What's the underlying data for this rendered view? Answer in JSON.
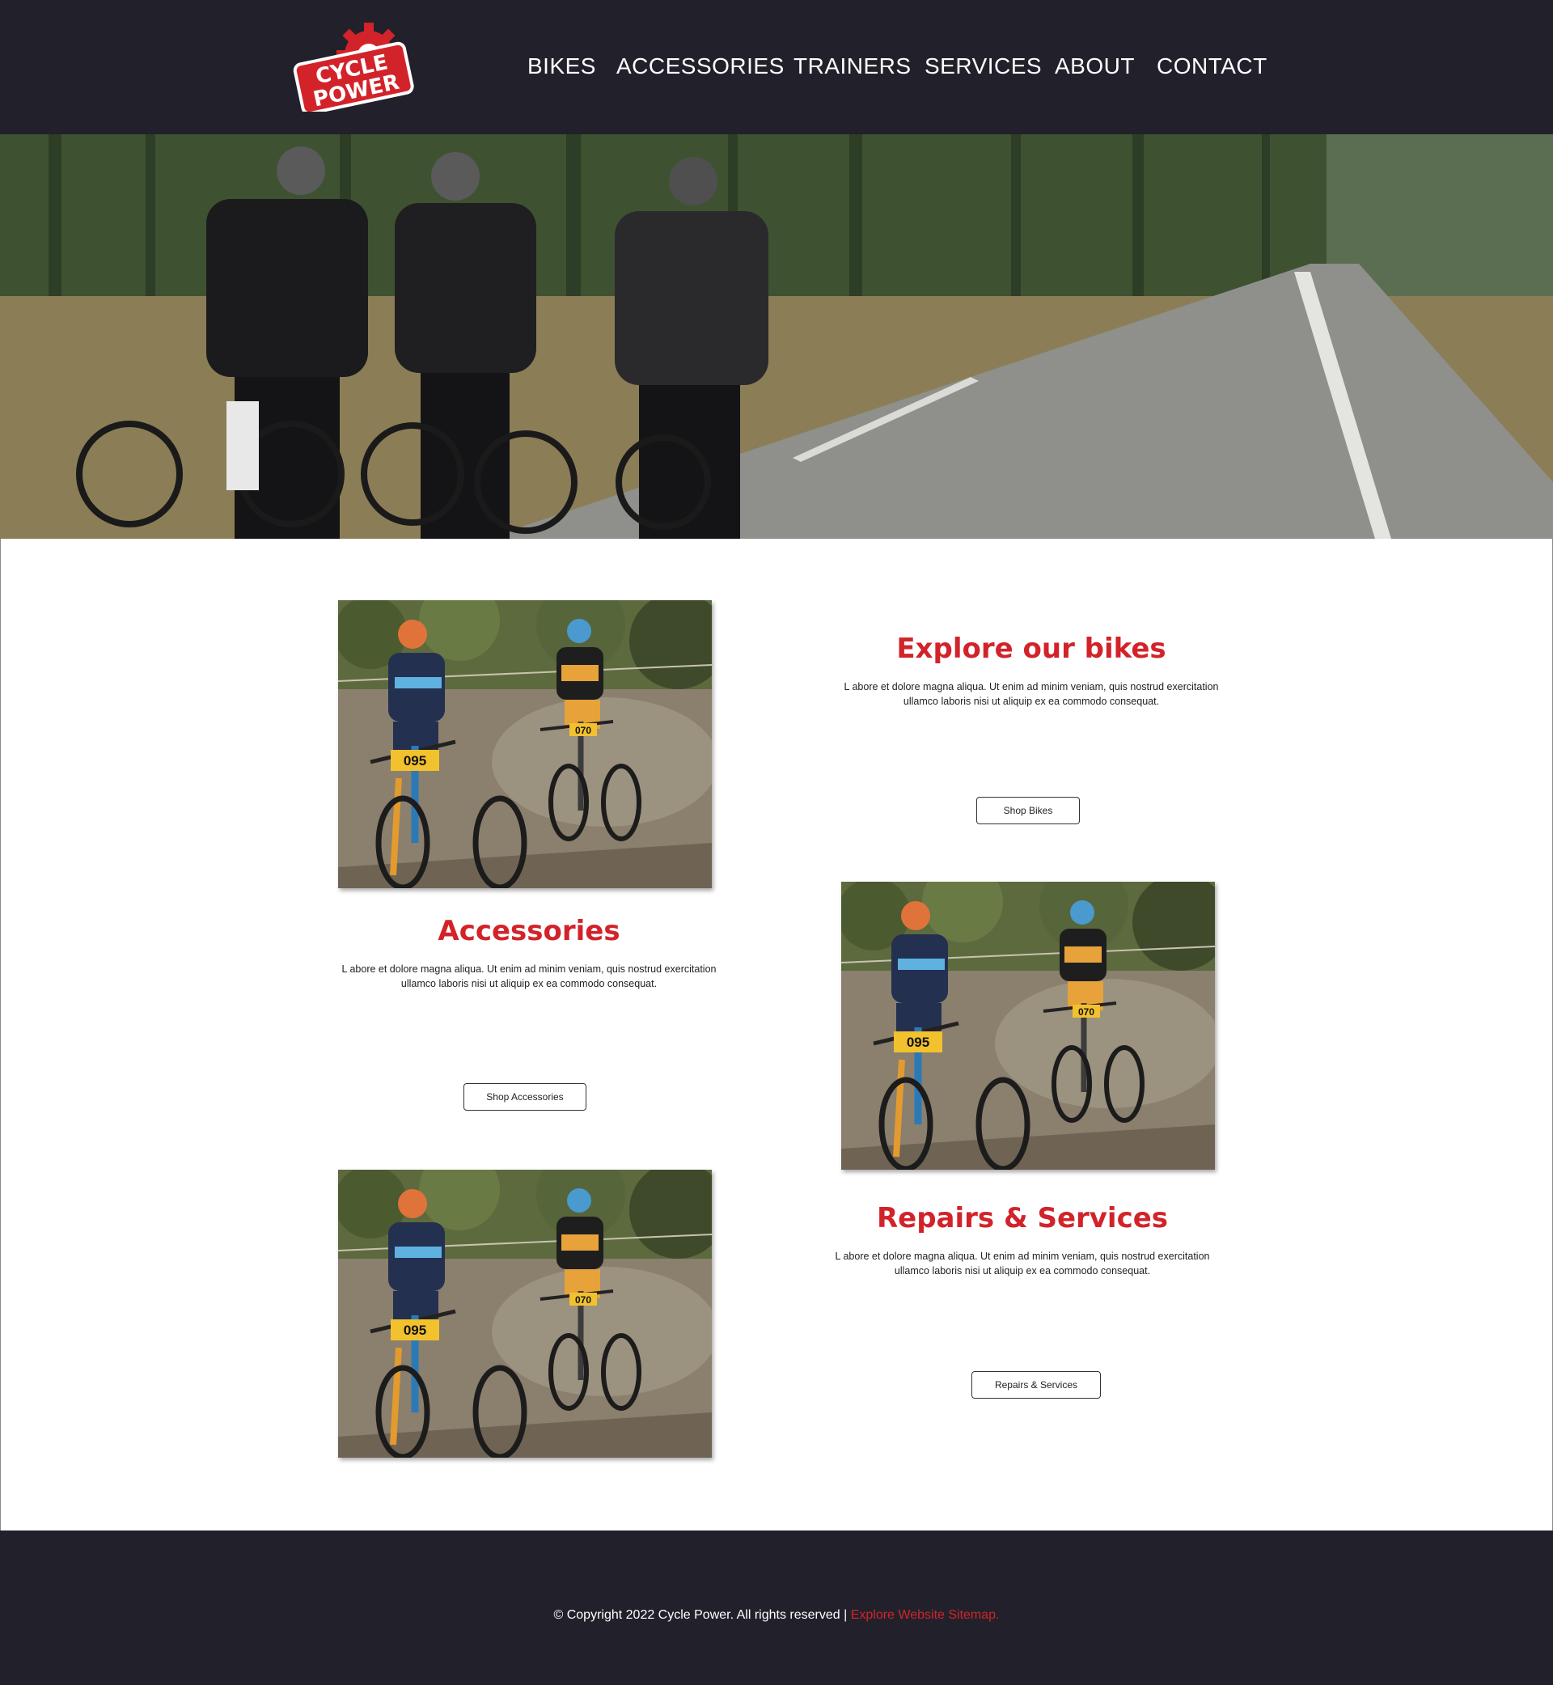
{
  "brand": {
    "logo_line1": "CYCLE",
    "logo_line2": "POWER",
    "accent": "#d2232a",
    "dark": "#22212b"
  },
  "nav": {
    "items": [
      {
        "label": "BIKES"
      },
      {
        "label": "ACCESSORIES"
      },
      {
        "label": "TRAINERS"
      },
      {
        "label": "SERVICES"
      },
      {
        "label": "ABOUT"
      },
      {
        "label": "CONTACT"
      }
    ]
  },
  "sections": {
    "bikes": {
      "title": "Explore our bikes",
      "body_line1": "L abore et dolore magna aliqua. Ut enim ad minim veniam, quis nostrud exercitation",
      "body_line2": "ullamco laboris nisi ut aliquip ex ea commodo consequat.",
      "button": "Shop Bikes"
    },
    "accessories": {
      "title": "Accessories",
      "body_line1": "L abore et dolore magna aliqua. Ut enim ad minim veniam, quis nostrud exercitation",
      "body_line2": "ullamco laboris nisi ut aliquip ex ea commodo consequat.",
      "button": "Shop Accessories"
    },
    "services": {
      "title": "Repairs & Services",
      "body_line1": "L abore et dolore magna aliqua. Ut enim ad minim veniam, quis nostrud exercitation",
      "body_line2": "ullamco laboris nisi ut aliquip ex ea commodo consequat.",
      "button": "Repairs & Services"
    }
  },
  "photos": {
    "rider1_number": "095",
    "rider2_number": "070"
  },
  "footer": {
    "copyright": "© Copyright 2022 Cycle Power. All rights reserved | ",
    "link": "Explore Website Sitemap."
  }
}
